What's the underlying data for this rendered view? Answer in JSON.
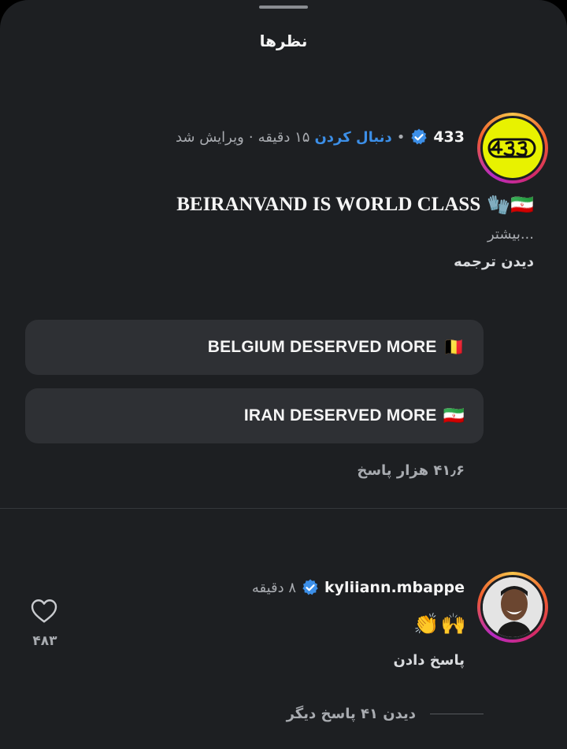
{
  "sheet": {
    "title": "نظرها"
  },
  "post": {
    "avatar_label": "433",
    "username": "433",
    "separator": "•",
    "follow_label": "دنبال کردن",
    "time": "۱۵ دقیقه",
    "dot": "·",
    "edited": "ویرایش شد",
    "caption_text": "BEIRANVAND IS WORLD CLASS",
    "caption_emojis": "🧤🇮🇷",
    "more_label": "...بیشتر",
    "translate_label": "دیدن ترجمه"
  },
  "poll": [
    {
      "label": "BELGIUM DESERVED MORE",
      "flag": "🇧🇪"
    },
    {
      "label": "IRAN DESERVED MORE",
      "flag": "🇮🇷"
    }
  ],
  "replies_count": "۴۱٫۶ هزار پاسخ",
  "reply": {
    "username": "kyliiann.mbappe",
    "time": "۸ دقیقه",
    "text_emojis": [
      "🙌",
      "👏"
    ],
    "reply_label": "پاسخ دادن",
    "likes": "۴۸۳",
    "view_more_label": "دیدن ۴۱ پاسخ دیگر"
  },
  "colors": {
    "background": "#1d1f22",
    "pill": "#2e3034",
    "follow_blue": "#3c8fe8",
    "verified_blue": "#3c8fe8",
    "avatar_433": "#e8f200"
  }
}
